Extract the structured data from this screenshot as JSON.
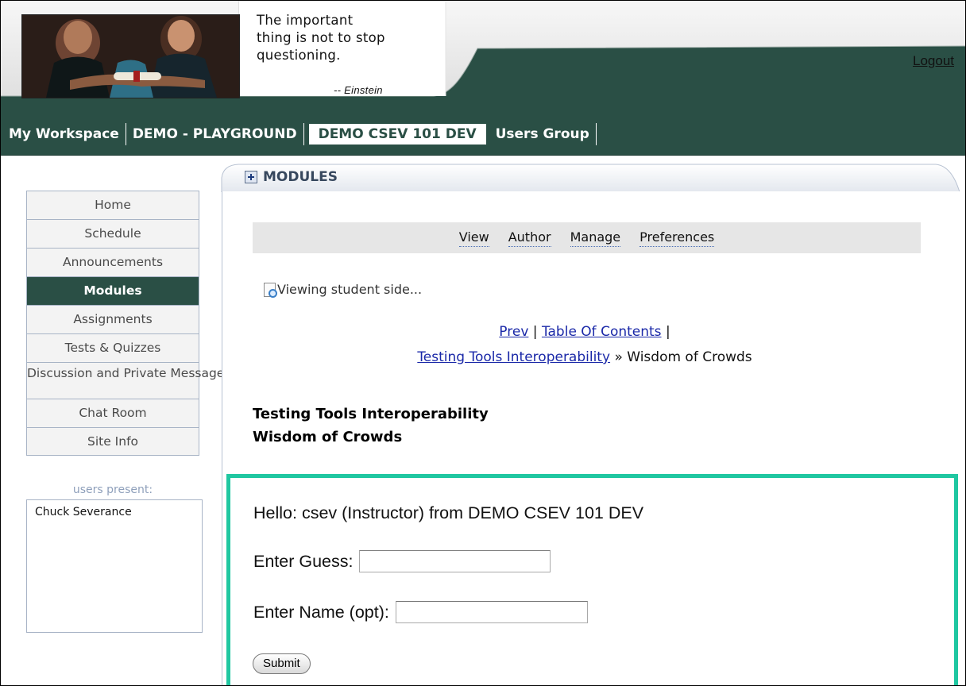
{
  "header": {
    "quote_lines": [
      "The important",
      "thing is not to stop",
      "questioning."
    ],
    "quote_author": "-- Einstein",
    "logout_label": "Logout"
  },
  "sites": [
    {
      "label": "My Workspace",
      "active": false
    },
    {
      "label": "DEMO - PLAYGROUND",
      "active": false
    },
    {
      "label": "DEMO CSEV 101 DEV",
      "active": true
    },
    {
      "label": "Users Group",
      "active": false
    }
  ],
  "tools": [
    {
      "label": "Home"
    },
    {
      "label": "Schedule"
    },
    {
      "label": "Announcements"
    },
    {
      "label": "Modules",
      "active": true
    },
    {
      "label": "Assignments"
    },
    {
      "label": "Tests & Quizzes"
    },
    {
      "label": "Discussion and Private Messages"
    },
    {
      "label": "Chat Room"
    },
    {
      "label": "Site Info"
    }
  ],
  "presence": {
    "title": "users present:",
    "users": [
      "Chuck Severance"
    ]
  },
  "portlet": {
    "title": "MODULES"
  },
  "subnav": [
    "View",
    "Author",
    "Manage",
    "Preferences"
  ],
  "viewing_text": "Viewing student side...",
  "module_nav": {
    "prev": "Prev",
    "sep": "|",
    "toc": "Table Of Contents",
    "sep2": "|",
    "parent": "Testing Tools Interoperability",
    "arrow": "»",
    "current": "Wisdom of Crowds"
  },
  "heading": {
    "line1": "Testing Tools Interoperability",
    "line2": "Wisdom of Crowds"
  },
  "lti": {
    "hello": "Hello: csev (Instructor) from DEMO CSEV 101 DEV",
    "guess_label": "Enter Guess:",
    "guess_value": "",
    "name_label": "Enter Name (opt):",
    "name_value": "",
    "submit_label": "Submit"
  },
  "colors": {
    "nav_green": "#2a4f45",
    "frame_teal": "#1fc7a1",
    "link_blue": "#1a28a8"
  }
}
